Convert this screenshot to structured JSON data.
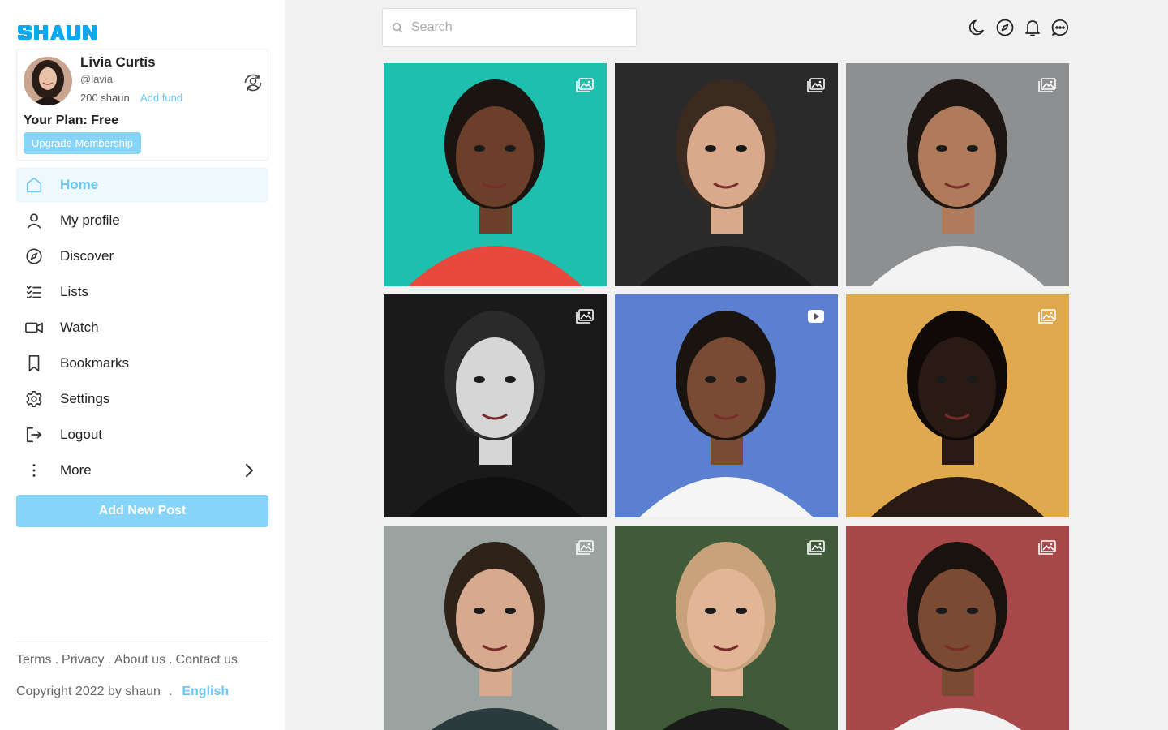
{
  "brand": {
    "logo_text": "SHAUN",
    "accent": "#6cc8f3",
    "accent_light": "#86d4f7",
    "logo_color": "#0aa8f0"
  },
  "profile": {
    "name": "Livia Curtis",
    "handle": "@lavia",
    "balance": "200 shaun",
    "add_fund": "Add fund",
    "plan": "Your Plan: Free",
    "upgrade": "Upgrade Membership"
  },
  "nav": [
    {
      "label": "Home",
      "icon": "home-icon",
      "active": true
    },
    {
      "label": "My profile",
      "icon": "user-icon"
    },
    {
      "label": "Discover",
      "icon": "compass-icon"
    },
    {
      "label": "Lists",
      "icon": "list-icon"
    },
    {
      "label": "Watch",
      "icon": "video-icon"
    },
    {
      "label": "Bookmarks",
      "icon": "bookmark-icon"
    },
    {
      "label": "Settings",
      "icon": "gear-icon"
    },
    {
      "label": "Logout",
      "icon": "logout-icon"
    },
    {
      "label": "More",
      "icon": "more-vertical-icon"
    }
  ],
  "add_post": "Add New Post",
  "footer": {
    "links": [
      "Terms",
      "Privacy",
      "About us",
      "Contact us"
    ],
    "copyright": "Copyright 2022 by shaun",
    "language": "English"
  },
  "search": {
    "placeholder": "Search"
  },
  "top_icons": [
    "moon-icon",
    "compass-icon",
    "bell-icon",
    "chat-icon"
  ],
  "posts": [
    {
      "type": "image",
      "bg": "#1fbfb0",
      "skin": "#6b3f2a",
      "hair": "#1b1410",
      "cloth": "#e8493d"
    },
    {
      "type": "image",
      "bg": "#2a2a2a",
      "skin": "#d9a98c",
      "hair": "#3b2a20",
      "cloth": "#1c1c1c"
    },
    {
      "type": "image",
      "bg": "#8d8f91",
      "skin": "#b07b5a",
      "hair": "#1d1612",
      "cloth": "#f3f3f3"
    },
    {
      "type": "image",
      "bg": "#1a1a1a",
      "skin": "#d6d6d6",
      "hair": "#2a2a2a",
      "cloth": "#101010"
    },
    {
      "type": "video",
      "bg": "#5b7fd1",
      "skin": "#7a4b33",
      "hair": "#1a1410",
      "cloth": "#f5f5f5"
    },
    {
      "type": "image",
      "bg": "#e0a94e",
      "skin": "#2a1a14",
      "hair": "#0f0a08",
      "cloth": "#2a1a14"
    },
    {
      "type": "image",
      "bg": "#9aa39f",
      "skin": "#d7a98e",
      "hair": "#2f2219",
      "cloth": "#2b3a3c"
    },
    {
      "type": "image",
      "bg": "#3f5b3a",
      "skin": "#e2b596",
      "hair": "#c7a27a",
      "cloth": "#1a1a1a"
    },
    {
      "type": "image",
      "bg": "#a8484a",
      "skin": "#7a4a33",
      "hair": "#1a120e",
      "cloth": "#f2f2f2"
    }
  ]
}
